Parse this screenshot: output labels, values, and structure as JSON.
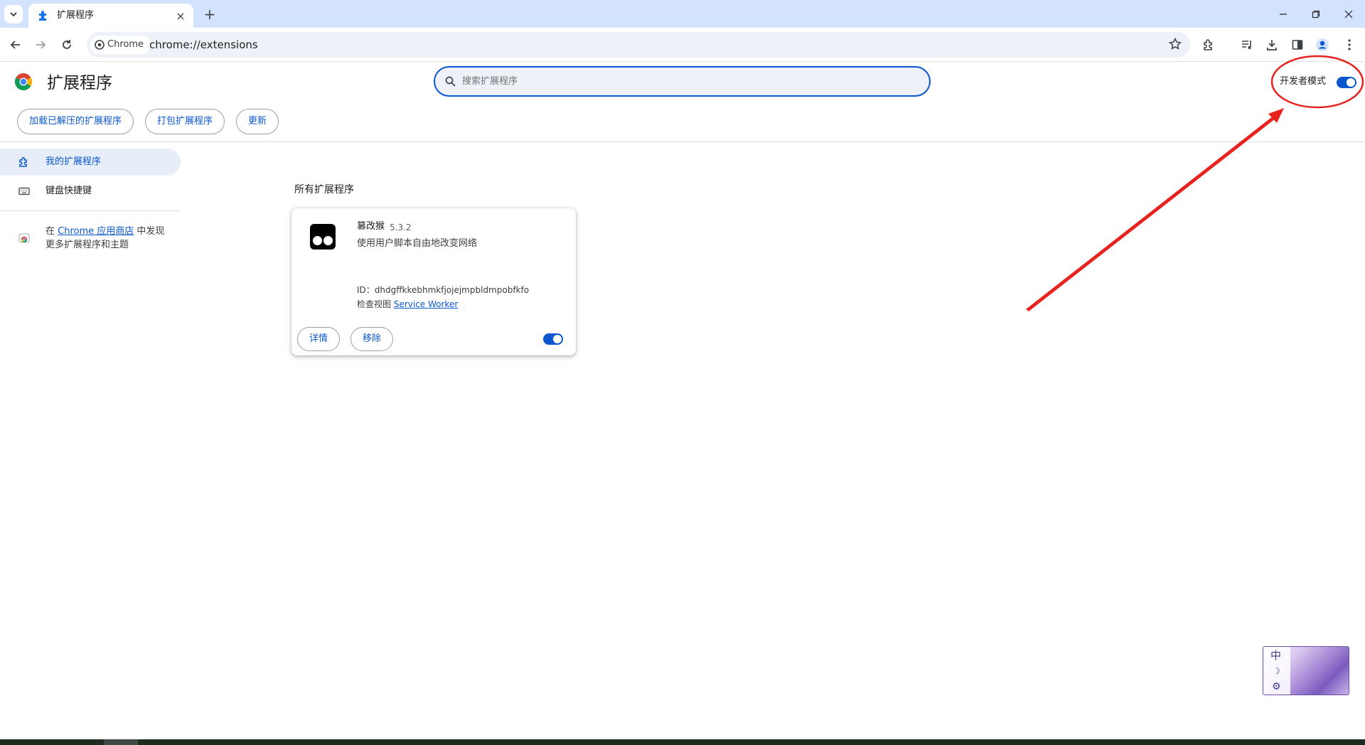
{
  "browser": {
    "tab": {
      "title": "扩展程序"
    },
    "address_bar": {
      "chip_label": "Chrome",
      "url": "chrome://extensions"
    }
  },
  "header": {
    "title": "扩展程序",
    "search_placeholder": "搜索扩展程序",
    "developer_mode_label": "开发者模式",
    "developer_mode_on": true,
    "actions": {
      "load_unpacked": "加载已解压的扩展程序",
      "pack": "打包扩展程序",
      "update": "更新"
    }
  },
  "sidebar": {
    "items": [
      {
        "label": "我的扩展程序",
        "icon": "extensions-icon",
        "active": true
      },
      {
        "label": "键盘快捷键",
        "icon": "keyboard-icon",
        "active": false
      }
    ],
    "store": {
      "prefix": "在 ",
      "link": "Chrome 应用商店",
      "suffix": " 中发现更多扩展程序和主题"
    }
  },
  "main": {
    "section_title": "所有扩展程序",
    "extension": {
      "name": "篡改猴",
      "version": "5.3.2",
      "description": "使用用户脚本自由地改变网络",
      "id_label": "ID：",
      "id_value": "dhdgffkkebhmkfjojejmpbldmpobfkfo",
      "inspect_label": "检查视图 ",
      "inspect_link": "Service Worker",
      "details_label": "详情",
      "remove_label": "移除",
      "enabled": true
    }
  },
  "ime": {
    "mode": "中",
    "moon": "☽",
    "gear": "⚙"
  },
  "colors": {
    "accent": "#0b57d0",
    "tabstrip": "#d3e3fd",
    "annotation": "#e8231f"
  }
}
